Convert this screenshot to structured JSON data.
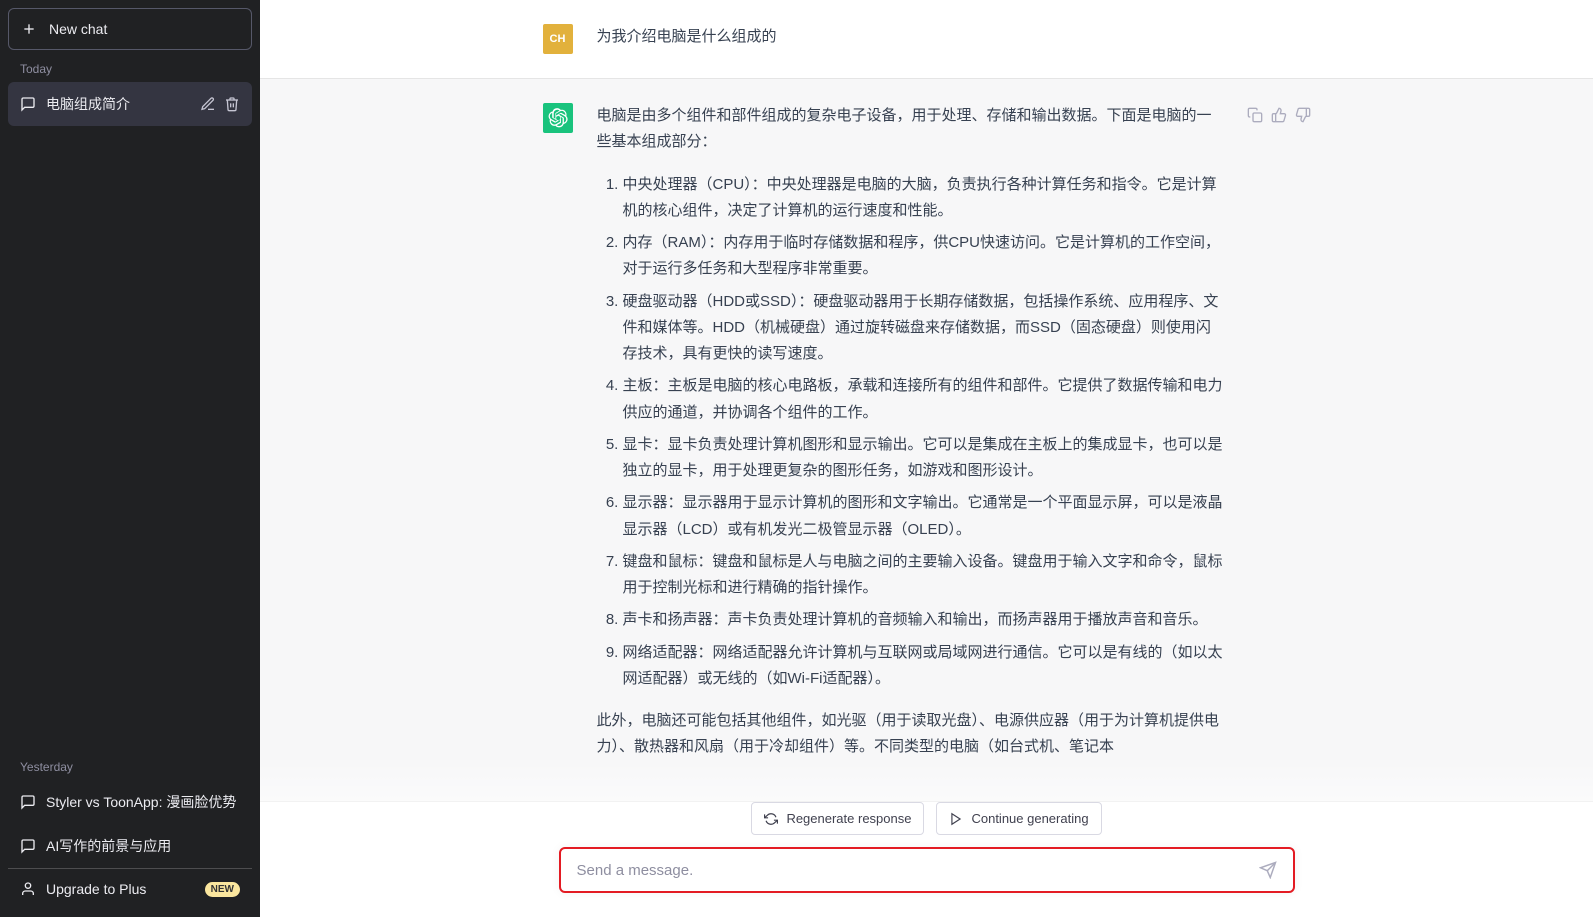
{
  "sidebar": {
    "new_chat_label": "New chat",
    "today_label": "Today",
    "yesterday_label": "Yesterday",
    "today_items": [
      {
        "title": "电脑组成简介"
      }
    ],
    "yesterday_items": [
      {
        "title": "Styler vs ToonApp: 漫画脸优势"
      },
      {
        "title": "AI写作的前景与应用"
      }
    ],
    "upgrade_label": "Upgrade to Plus",
    "upgrade_badge": "NEW"
  },
  "conversation": {
    "user_avatar_label": "CH",
    "user_message": "为我介绍电脑是什么组成的",
    "assistant_intro": "电脑是由多个组件和部件组成的复杂电子设备，用于处理、存储和输出数据。下面是电脑的一些基本组成部分：",
    "assistant_list": [
      "中央处理器（CPU）：中央处理器是电脑的大脑，负责执行各种计算任务和指令。它是计算机的核心组件，决定了计算机的运行速度和性能。",
      "内存（RAM）：内存用于临时存储数据和程序，供CPU快速访问。它是计算机的工作空间，对于运行多任务和大型程序非常重要。",
      "硬盘驱动器（HDD或SSD）：硬盘驱动器用于长期存储数据，包括操作系统、应用程序、文件和媒体等。HDD（机械硬盘）通过旋转磁盘来存储数据，而SSD（固态硬盘）则使用闪存技术，具有更快的读写速度。",
      "主板：主板是电脑的核心电路板，承载和连接所有的组件和部件。它提供了数据传输和电力供应的通道，并协调各个组件的工作。",
      "显卡：显卡负责处理计算机图形和显示输出。它可以是集成在主板上的集成显卡，也可以是独立的显卡，用于处理更复杂的图形任务，如游戏和图形设计。",
      "显示器：显示器用于显示计算机的图形和文字输出。它通常是一个平面显示屏，可以是液晶显示器（LCD）或有机发光二极管显示器（OLED）。",
      "键盘和鼠标：键盘和鼠标是人与电脑之间的主要输入设备。键盘用于输入文字和命令，鼠标用于控制光标和进行精确的指针操作。",
      "声卡和扬声器：声卡负责处理计算机的音频输入和输出，而扬声器用于播放声音和音乐。",
      "网络适配器：网络适配器允许计算机与互联网或局域网进行通信。它可以是有线的（如以太网适配器）或无线的（如Wi-Fi适配器）。"
    ],
    "assistant_outro": "此外，电脑还可能包括其他组件，如光驱（用于读取光盘）、电源供应器（用于为计算机提供电力）、散热器和风扇（用于冷却组件）等。不同类型的电脑（如台式机、笔记本"
  },
  "bottom": {
    "regenerate_label": "Regenerate response",
    "continue_label": "Continue generating",
    "input_placeholder": "Send a message."
  }
}
